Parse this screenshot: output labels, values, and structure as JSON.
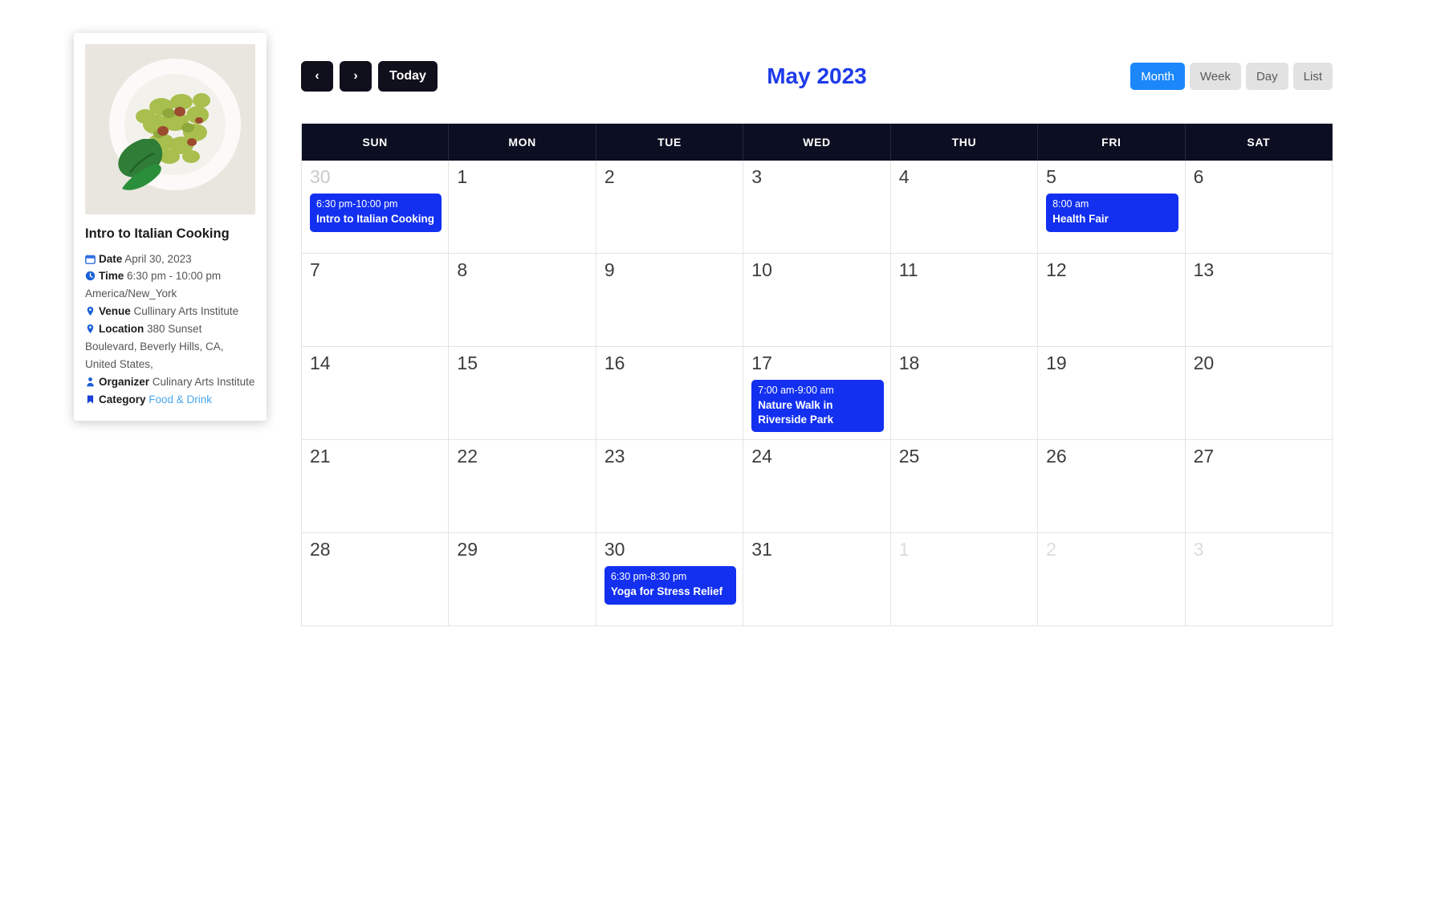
{
  "toolbar": {
    "prev_label": "‹",
    "next_label": "›",
    "today_label": "Today",
    "title": "May 2023",
    "views": [
      {
        "label": "Month",
        "active": true
      },
      {
        "label": "Week",
        "active": false
      },
      {
        "label": "Day",
        "active": false
      },
      {
        "label": "List",
        "active": false
      }
    ]
  },
  "weekdays": [
    "SUN",
    "MON",
    "TUE",
    "WED",
    "THU",
    "FRI",
    "SAT"
  ],
  "weeks": [
    [
      {
        "num": "30",
        "muted": "other",
        "events": [
          {
            "time": "6:30 pm-10:00 pm",
            "title": "Intro to Italian Cooking"
          }
        ]
      },
      {
        "num": "1",
        "muted": "",
        "events": []
      },
      {
        "num": "2",
        "muted": "",
        "events": []
      },
      {
        "num": "3",
        "muted": "",
        "events": []
      },
      {
        "num": "4",
        "muted": "",
        "events": []
      },
      {
        "num": "5",
        "muted": "",
        "events": [
          {
            "time": "8:00 am",
            "title": "Health Fair"
          }
        ]
      },
      {
        "num": "6",
        "muted": "",
        "events": []
      }
    ],
    [
      {
        "num": "7",
        "muted": "",
        "events": []
      },
      {
        "num": "8",
        "muted": "",
        "events": []
      },
      {
        "num": "9",
        "muted": "",
        "events": []
      },
      {
        "num": "10",
        "muted": "",
        "events": []
      },
      {
        "num": "11",
        "muted": "",
        "events": []
      },
      {
        "num": "12",
        "muted": "",
        "events": []
      },
      {
        "num": "13",
        "muted": "",
        "events": []
      }
    ],
    [
      {
        "num": "14",
        "muted": "",
        "events": []
      },
      {
        "num": "15",
        "muted": "",
        "events": []
      },
      {
        "num": "16",
        "muted": "",
        "events": []
      },
      {
        "num": "17",
        "muted": "",
        "events": [
          {
            "time": "7:00 am-9:00 am",
            "title": "Nature Walk in Riverside Park"
          }
        ]
      },
      {
        "num": "18",
        "muted": "",
        "events": []
      },
      {
        "num": "19",
        "muted": "",
        "events": []
      },
      {
        "num": "20",
        "muted": "",
        "events": []
      }
    ],
    [
      {
        "num": "21",
        "muted": "",
        "events": []
      },
      {
        "num": "22",
        "muted": "",
        "events": []
      },
      {
        "num": "23",
        "muted": "",
        "events": []
      },
      {
        "num": "24",
        "muted": "",
        "events": []
      },
      {
        "num": "25",
        "muted": "",
        "events": []
      },
      {
        "num": "26",
        "muted": "",
        "events": []
      },
      {
        "num": "27",
        "muted": "",
        "events": []
      }
    ],
    [
      {
        "num": "28",
        "muted": "",
        "events": []
      },
      {
        "num": "29",
        "muted": "",
        "events": []
      },
      {
        "num": "30",
        "muted": "",
        "events": [
          {
            "time": "6:30 pm-8:30 pm",
            "title": "Yoga for Stress Relief"
          }
        ]
      },
      {
        "num": "31",
        "muted": "",
        "events": []
      },
      {
        "num": "1",
        "muted": "other-faint",
        "events": []
      },
      {
        "num": "2",
        "muted": "other-faint",
        "events": []
      },
      {
        "num": "3",
        "muted": "other-faint",
        "events": []
      }
    ]
  ],
  "tooltip": {
    "title": "Intro to Italian Cooking",
    "image_alt": "pasta-pesto-dish-photo",
    "date_label": "Date",
    "date_value": "April 30, 2023",
    "time_label": "Time",
    "time_value": "6:30 pm - 10:00 pm America/New_York",
    "venue_label": "Venue",
    "venue_value": "Cullinary Arts Institute",
    "location_label": "Location",
    "location_value": "380 Sunset Boulevard, Beverly Hills, CA, United States,",
    "organizer_label": "Organizer",
    "organizer_value": "Culinary Arts Institute",
    "category_label": "Category",
    "category_value": "Food & Drink"
  },
  "colors": {
    "accent_blue": "#1b87fb",
    "title_blue": "#1f3bea",
    "event_blue": "#1330f0",
    "header_dark": "#0c0f21",
    "category_link": "#4aa8ef"
  }
}
